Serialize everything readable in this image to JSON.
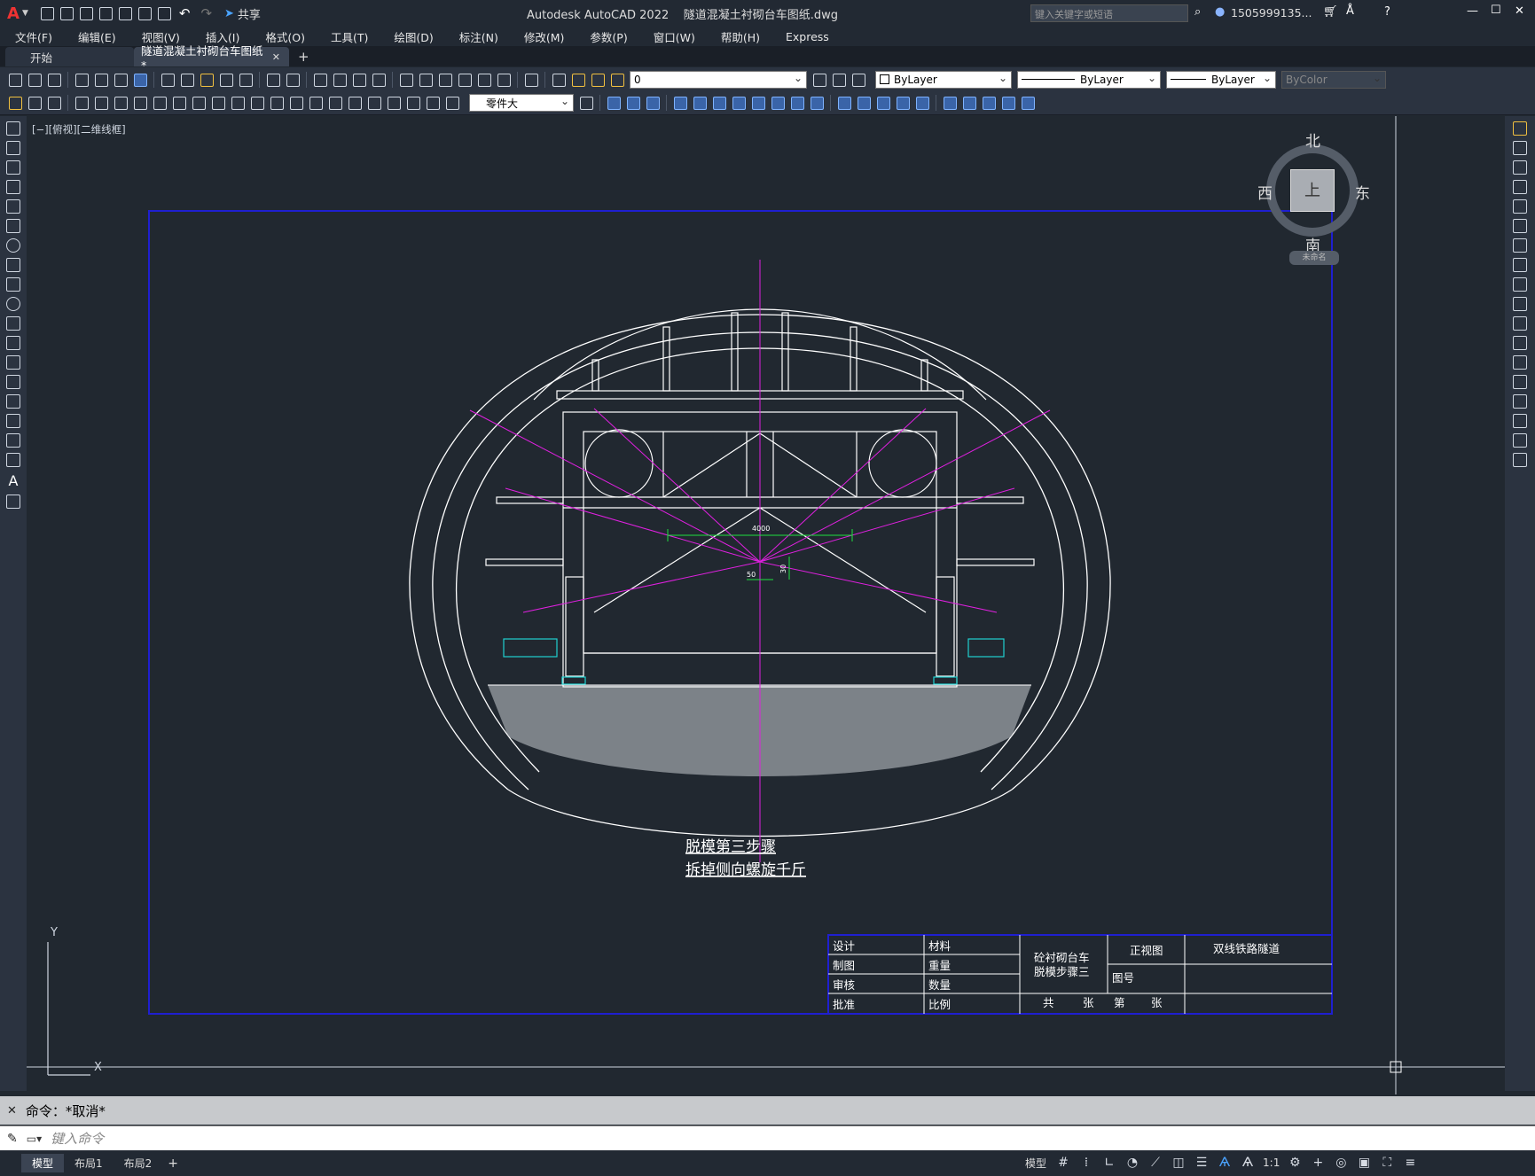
{
  "window": {
    "title": "Autodesk AutoCAD 2022    隧道混凝土衬砌台车图纸.dwg",
    "share_label": "共享",
    "search_placeholder": "键入关键字或短语",
    "user": "1505999135...",
    "min": "—",
    "max": "☐",
    "close": "✕"
  },
  "menu": [
    "文件(F)",
    "编辑(E)",
    "视图(V)",
    "插入(I)",
    "格式(O)",
    "工具(T)",
    "绘图(D)",
    "标注(N)",
    "修改(M)",
    "参数(P)",
    "窗口(W)",
    "帮助(H)",
    "Express"
  ],
  "tabs": {
    "start": "开始",
    "doc": "隧道混凝土衬砌台车图纸*",
    "close": "✕",
    "add": "+"
  },
  "toolbar": {
    "layer_value": "0",
    "color": "ByLayer",
    "linetype": "ByLayer",
    "lineweight": "ByLayer",
    "plotstyle": "ByColor",
    "textstyle": "零件大"
  },
  "viewport": {
    "label": "[−][俯视][二维线框]"
  },
  "viewcube": {
    "north": "北",
    "south": "南",
    "east": "东",
    "west": "西",
    "top": "上",
    "wcs": "未命名"
  },
  "drawing": {
    "dim_width": "4000",
    "dim_a": "50",
    "dim_b": "30",
    "caption_line1": "脱模第三步骤",
    "caption_line2": "拆掉侧向螺旋千斤",
    "ucs_y": "Y",
    "ucs_x": "X"
  },
  "titleblock": {
    "labels": [
      "设计",
      "制图",
      "审核",
      "批准"
    ],
    "labels2": [
      "材料",
      "重量",
      "数量",
      "比例"
    ],
    "name_line1": "砼衬砌台车",
    "name_line2": "脱模步骤三",
    "view": "正视图",
    "project": "双线铁路隧道",
    "figno": "图号",
    "gong": "共",
    "zhang1": "张",
    "di": "第",
    "zhang2": "张"
  },
  "command": {
    "history": "命令：*取消*",
    "placeholder": "键入命令"
  },
  "layouts": [
    "模型",
    "布局1",
    "布局2"
  ],
  "status": {
    "model": "模型",
    "scale": "1:1"
  }
}
